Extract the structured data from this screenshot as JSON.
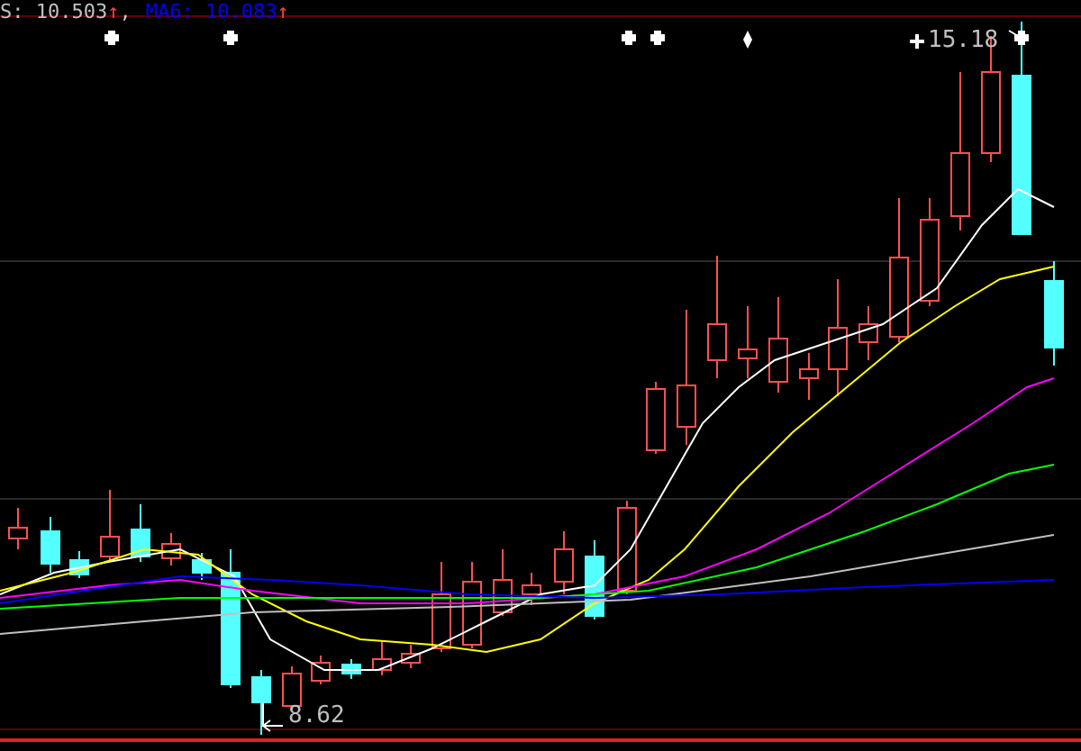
{
  "legend": [
    {
      "text": "S: 10.503",
      "color": "#c0c0c0",
      "arrow": "↑",
      "separator": ","
    },
    {
      "text": "MA6: 10.083",
      "color": "#0000ff",
      "arrow": "↑"
    }
  ],
  "price_labels": {
    "high": "15.18",
    "low": "8.62"
  }
}
